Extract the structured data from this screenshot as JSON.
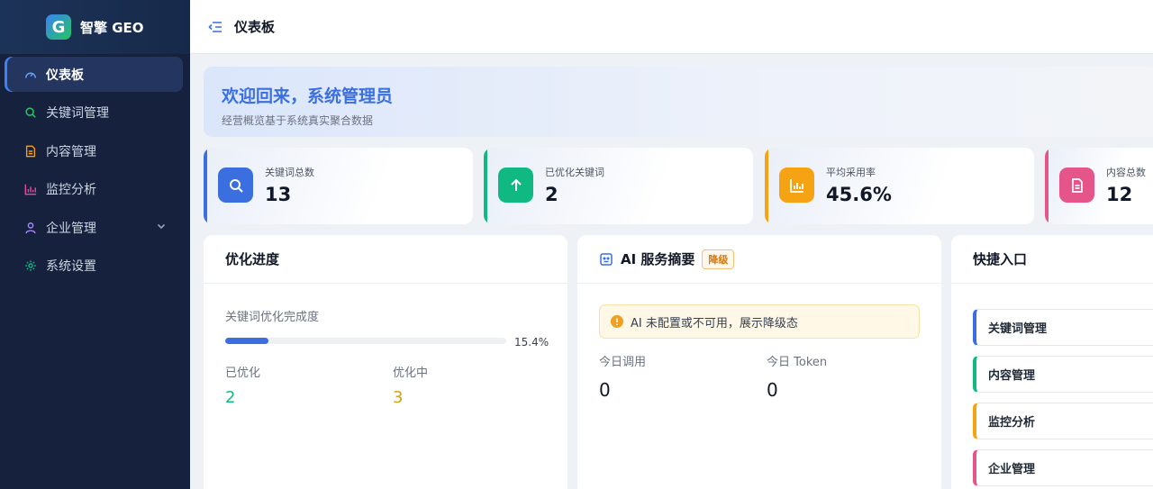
{
  "app": {
    "name": "智擎 GEO",
    "logo_letter": "G"
  },
  "sidebar": {
    "items": [
      {
        "label": "仪表板",
        "icon": "dashboard-icon",
        "active": true
      },
      {
        "label": "关键词管理",
        "icon": "search-icon",
        "color": "#22c55e"
      },
      {
        "label": "内容管理",
        "icon": "document-icon",
        "color": "#f59e0b"
      },
      {
        "label": "监控分析",
        "icon": "chart-icon",
        "color": "#ec4899"
      },
      {
        "label": "企业管理",
        "icon": "user-icon",
        "color": "#a78bfa",
        "has_children": true
      },
      {
        "label": "系统设置",
        "icon": "gear-icon",
        "color": "#10b981"
      }
    ]
  },
  "header": {
    "title": "仪表板"
  },
  "welcome": {
    "title": "欢迎回来，系统管理员",
    "subtitle": "经营概览基于系统真实聚合数据"
  },
  "stats": [
    {
      "label": "关键词总数",
      "value": "13",
      "color": "#3b6fe0",
      "icon": "search-icon"
    },
    {
      "label": "已优化关键词",
      "value": "2",
      "color": "#10b981",
      "icon": "arrow-up-icon"
    },
    {
      "label": "平均采用率",
      "value": "45.6%",
      "color": "#f5a313",
      "icon": "bar-chart-icon"
    },
    {
      "label": "内容总数",
      "value": "12",
      "color": "#e5558a",
      "icon": "document-icon"
    }
  ],
  "progress": {
    "title": "优化进度",
    "label": "关键词优化完成度",
    "percent_text": "15.4%",
    "percent": 15.4,
    "optimized_label": "已优化",
    "optimized_value": "2",
    "optimized_color": "#10b981",
    "in_progress_label": "优化中",
    "in_progress_value": "3",
    "in_progress_color": "#d4a017"
  },
  "ai": {
    "title": "AI 服务摘要",
    "badge": "降级",
    "warning": "AI 未配置或不可用，展示降级态",
    "calls_label": "今日调用",
    "calls_value": "0",
    "token_label": "今日 Token",
    "token_value": "0"
  },
  "quick": {
    "title": "快捷入口",
    "items": [
      {
        "label": "关键词管理",
        "color": "#3b6fe0"
      },
      {
        "label": "内容管理",
        "color": "#10b981"
      },
      {
        "label": "监控分析",
        "color": "#f5a313"
      },
      {
        "label": "企业管理",
        "color": "#e5558a"
      }
    ]
  }
}
